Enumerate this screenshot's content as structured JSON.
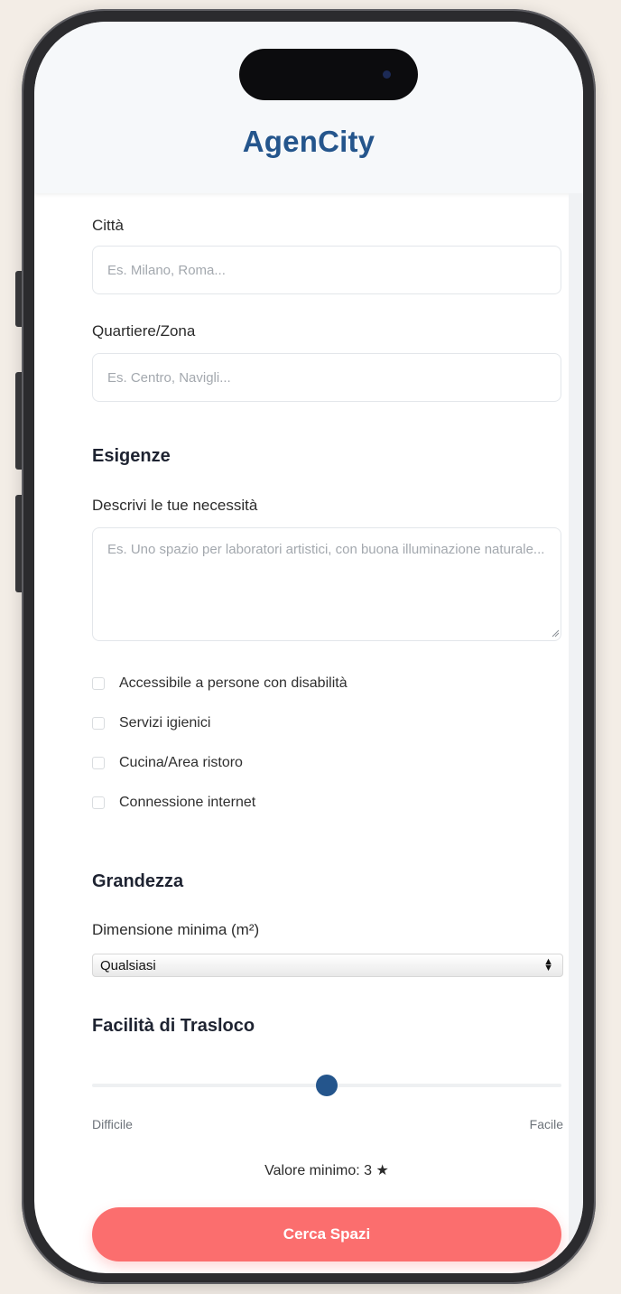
{
  "app": {
    "title": "AgenCity"
  },
  "location": {
    "city_label": "Città",
    "city_placeholder": "Es. Milano, Roma...",
    "city_value": "",
    "zone_label": "Quartiere/Zona",
    "zone_placeholder": "Es. Centro, Navigli...",
    "zone_value": ""
  },
  "needs": {
    "section_title": "Esigenze",
    "description_label": "Descrivi le tue necessità",
    "description_placeholder": "Es. Uno spazio per laboratori artistici, con buona illuminazione naturale...",
    "description_value": "",
    "options": [
      {
        "label": "Accessibile a persone con disabilità",
        "checked": false
      },
      {
        "label": "Servizi igienici",
        "checked": false
      },
      {
        "label": "Cucina/Area ristoro",
        "checked": false
      },
      {
        "label": "Connessione internet",
        "checked": false
      }
    ]
  },
  "size": {
    "section_title": "Grandezza",
    "min_label": "Dimensione minima (m²)",
    "selected_option": "Qualsiasi"
  },
  "moving": {
    "section_title": "Facilità di Trasloco",
    "slider_min": 1,
    "slider_max": 5,
    "slider_value": 3,
    "low_label": "Difficile",
    "high_label": "Facile",
    "min_value_text": "Valore minimo: 3 ★"
  },
  "actions": {
    "search_label": "Cerca Spazi"
  },
  "colors": {
    "brand": "#24558c",
    "accent": "#fb6e6e",
    "header_bg": "#f6f8fa"
  }
}
